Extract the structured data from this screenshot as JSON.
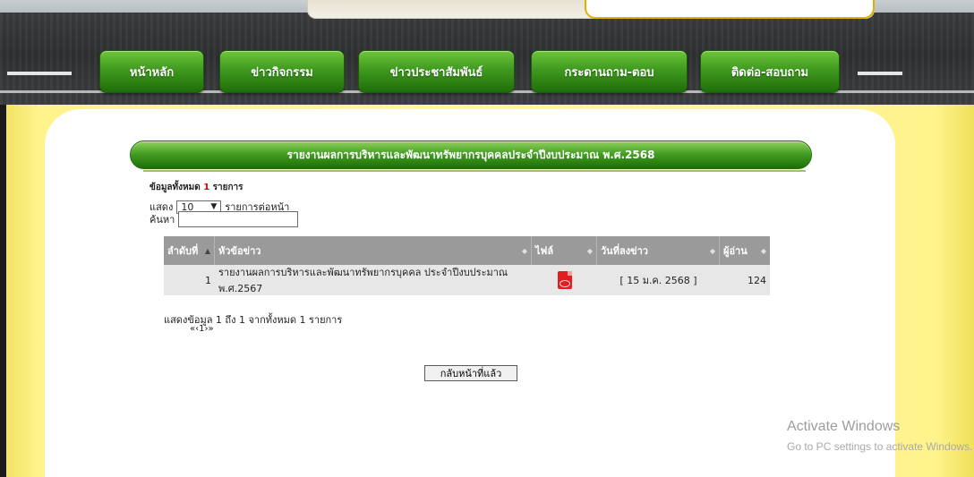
{
  "nav": {
    "items": [
      {
        "label": "หน้าหลัก"
      },
      {
        "label": "ข่าวกิจกรรม"
      },
      {
        "label": "ข่าวประชาสัมพันธ์"
      },
      {
        "label": "กระดานถาม-ตอบ"
      },
      {
        "label": "ติดต่อ-สอบถาม"
      }
    ]
  },
  "page": {
    "title": "รายงานผลการบริหารและพัฒนาทรัพยากรบุคคลประจำปีงบประมาณ พ.ศ.2568"
  },
  "list": {
    "count_prefix": "ข้อมูลทั้งหมด",
    "count_value": "1",
    "count_suffix": "รายการ",
    "show_label": "แสดง",
    "per_page_value": "10",
    "per_page_suffix": "รายการต่อหน้า",
    "search_label": "ค้นหา",
    "search_value": ""
  },
  "table": {
    "headers": [
      "ลำดับที่",
      "หัวข้อข่าว",
      "ไฟล์",
      "วันที่ลงข่าว",
      "ผู้อ่าน"
    ],
    "rows": [
      {
        "no": "1",
        "title": "รายงานผลการบริหารและพัฒนาทรัพยากรบุคคล ประจำปีงบประมาณ พ.ศ.2567",
        "file_icon": "pdf-icon",
        "date": "[ 15 ม.ค. 2568 ]",
        "views": "124"
      }
    ]
  },
  "summary": "แสดงข้อมูล 1 ถึง 1 จากทั้งหมด 1 รายการ",
  "pager": "«‹1›»",
  "back_button": "กลับหน้าที่แล้ว",
  "os_watermark": {
    "title": "Activate Windows",
    "subtitle": "Go to PC settings to activate Windows."
  },
  "colors": {
    "nav_green": "#3f9a1f",
    "body_yellow": "#fff38c",
    "table_header": "#9a9a9a",
    "count_red": "#d00000"
  }
}
